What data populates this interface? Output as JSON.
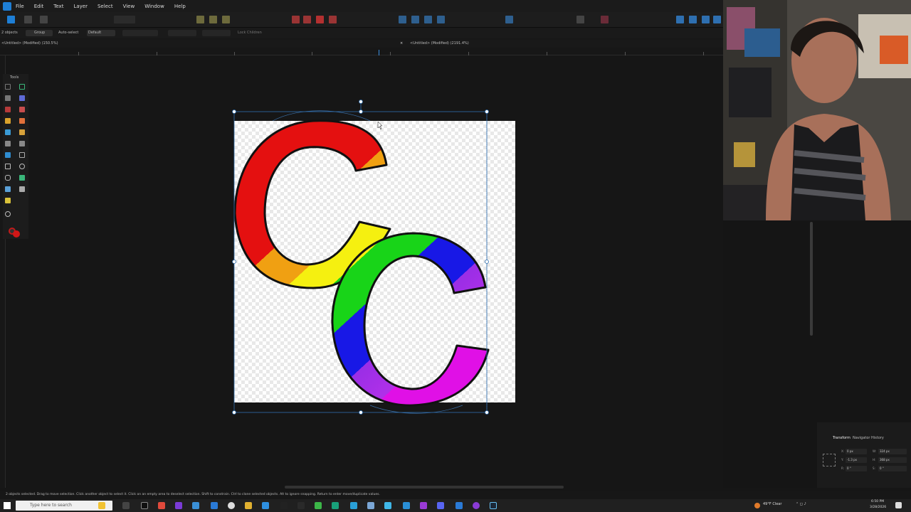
{
  "menu": [
    "File",
    "Edit",
    "Text",
    "Layer",
    "Select",
    "View",
    "Window",
    "Help"
  ],
  "context": {
    "selection_count": "2 objects",
    "group_button": "Group",
    "auto_select": "Auto-select",
    "auto_select_mode": "Default",
    "lock_children": "Lock Children"
  },
  "tabs": [
    "<Untitled> (Modified) (150.5%)",
    "<Untitled> (Modified) (2191.4%)"
  ],
  "tools_title": "Tools",
  "transform": {
    "tabs": [
      "Transform",
      "Navigator",
      "History"
    ],
    "x": "0 px",
    "y": "-1.3 px",
    "w": "324 px",
    "h": "368 px",
    "r": "0 °",
    "s": "0 °"
  },
  "status_text": "2 objects selected. Drag to move selection. Click another object to select it. Click on an empty area to deselect selection. Shift to constrain. Ctrl to clone selected objects. Alt to ignore snapping. Return to enter move/duplicate values.",
  "taskbar": {
    "search_placeholder": "Type here to search",
    "weather": "49°F Clear",
    "time": "6:50 PM",
    "date": "3/28/2026"
  },
  "colors": {
    "accent": "#1e7fd6",
    "selection": "#2f6fb0"
  }
}
